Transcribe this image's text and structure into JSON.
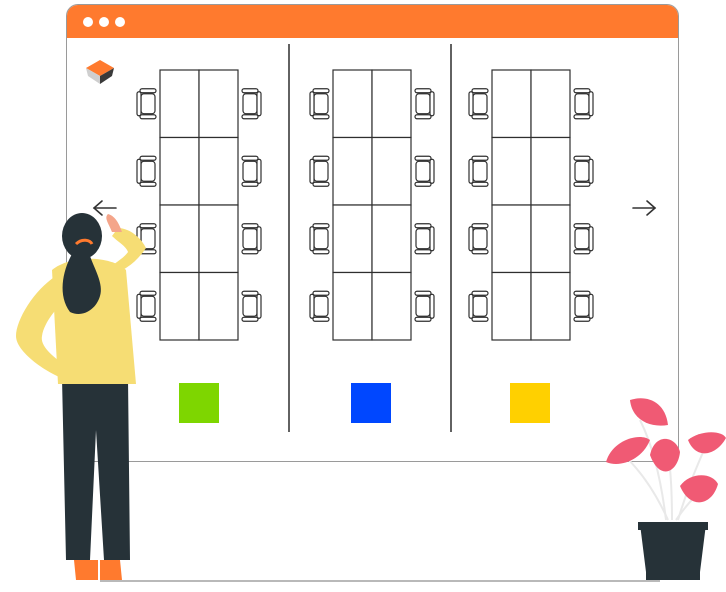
{
  "colors": {
    "titlebar": "#ff7a2e",
    "outline": "#2f2f2f",
    "zone_1": "#7ed600",
    "zone_2": "#0047ff",
    "zone_3": "#ffd000",
    "person_top": "#f6dd74",
    "person_pants": "#263238",
    "person_shoes": "#ff7a2e",
    "person_hair": "#263238",
    "skin": "#f4a58a",
    "plant_leaf": "#f05a74",
    "pot": "#263238"
  },
  "window": {
    "controls": [
      "window-dot",
      "window-dot",
      "window-dot"
    ]
  },
  "icons": {
    "logo": "cube-logo-icon",
    "prev": "arrow-left-icon",
    "next": "arrow-right-icon"
  },
  "sections": [
    {
      "name": "section-1",
      "swatch": "#7ed600"
    },
    {
      "name": "section-2",
      "swatch": "#0047ff"
    },
    {
      "name": "section-3",
      "swatch": "#ffd000"
    }
  ]
}
